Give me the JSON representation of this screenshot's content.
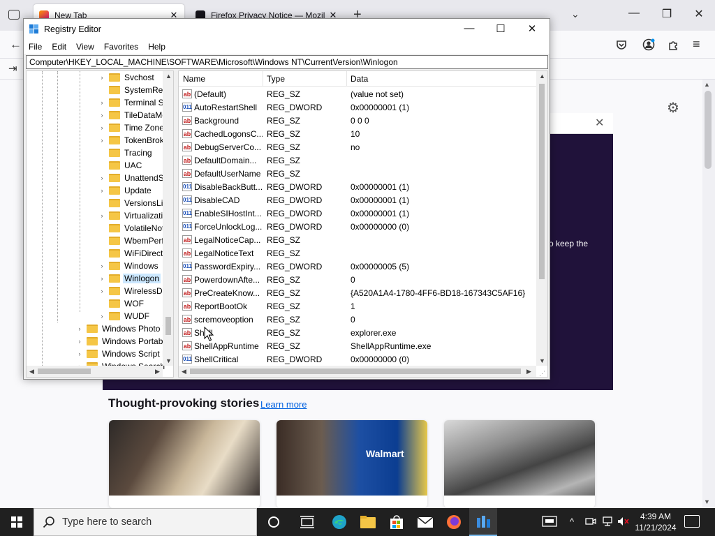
{
  "firefox": {
    "tabs": [
      {
        "label": "New Tab",
        "close": "✕"
      },
      {
        "label": "Firefox Privacy Notice — Mozil",
        "close": "✕"
      }
    ],
    "new_tab": "+",
    "tabs_menu": "⌄",
    "window_controls": {
      "minimize": "—",
      "maximize": "❐",
      "close": "✕"
    },
    "nav": {
      "back": "←",
      "import": "⇥"
    },
    "toolbar_icons": {
      "pocket": "pocket-icon",
      "account": "account-icon",
      "extensions": "extensions-icon",
      "menu": "≡"
    },
    "gear": "⚙",
    "dialog_close": "✕",
    "promo_text": "o keep the",
    "stories_title": "Thought-provoking stories",
    "learn_more": "Learn more",
    "card_brand": "Walmart"
  },
  "regedit": {
    "title": "Registry Editor",
    "window_controls": {
      "minimize": "—",
      "maximize": "☐",
      "close": "✕"
    },
    "menu": [
      "File",
      "Edit",
      "View",
      "Favorites",
      "Help"
    ],
    "address": "Computer\\HKEY_LOCAL_MACHINE\\SOFTWARE\\Microsoft\\Windows NT\\CurrentVersion\\Winlogon",
    "tree": [
      {
        "label": "Svchost",
        "expandable": true
      },
      {
        "label": "SystemRest",
        "expandable": false
      },
      {
        "label": "Terminal Se",
        "expandable": true
      },
      {
        "label": "TileDataMo",
        "expandable": true
      },
      {
        "label": "Time Zones",
        "expandable": true
      },
      {
        "label": "TokenBroke",
        "expandable": true
      },
      {
        "label": "Tracing",
        "expandable": false
      },
      {
        "label": "UAC",
        "expandable": false
      },
      {
        "label": "UnattendSe",
        "expandable": true
      },
      {
        "label": "Update",
        "expandable": true
      },
      {
        "label": "VersionsList",
        "expandable": false
      },
      {
        "label": "Virtualizatic",
        "expandable": true
      },
      {
        "label": "VolatileNot",
        "expandable": false
      },
      {
        "label": "WbemPerf",
        "expandable": false
      },
      {
        "label": "WiFiDirectA",
        "expandable": false
      },
      {
        "label": "Windows",
        "expandable": true
      },
      {
        "label": "Winlogon",
        "expandable": true,
        "selected": true
      },
      {
        "label": "WirelessDo",
        "expandable": true
      },
      {
        "label": "WOF",
        "expandable": false
      },
      {
        "label": "WUDF",
        "expandable": true
      },
      {
        "label": "Windows Photo V",
        "expandable": true,
        "level": 0
      },
      {
        "label": "Windows Portabl",
        "expandable": true,
        "level": 0
      },
      {
        "label": "Windows Script H",
        "expandable": true,
        "level": 0
      },
      {
        "label": "Windows Search",
        "expandable": true,
        "level": 0
      }
    ],
    "columns": {
      "name": "Name",
      "type": "Type",
      "data": "Data"
    },
    "values": [
      {
        "name": "(Default)",
        "type": "REG_SZ",
        "data": "(value not set)"
      },
      {
        "name": "AutoRestartShell",
        "type": "REG_DWORD",
        "data": "0x00000001 (1)"
      },
      {
        "name": "Background",
        "type": "REG_SZ",
        "data": "0 0 0"
      },
      {
        "name": "CachedLogonsC...",
        "type": "REG_SZ",
        "data": "10"
      },
      {
        "name": "DebugServerCo...",
        "type": "REG_SZ",
        "data": "no"
      },
      {
        "name": "DefaultDomain...",
        "type": "REG_SZ",
        "data": ""
      },
      {
        "name": "DefaultUserName",
        "type": "REG_SZ",
        "data": ""
      },
      {
        "name": "DisableBackButt...",
        "type": "REG_DWORD",
        "data": "0x00000001 (1)"
      },
      {
        "name": "DisableCAD",
        "type": "REG_DWORD",
        "data": "0x00000001 (1)"
      },
      {
        "name": "EnableSIHostInt...",
        "type": "REG_DWORD",
        "data": "0x00000001 (1)"
      },
      {
        "name": "ForceUnlockLog...",
        "type": "REG_DWORD",
        "data": "0x00000000 (0)"
      },
      {
        "name": "LegalNoticeCap...",
        "type": "REG_SZ",
        "data": ""
      },
      {
        "name": "LegalNoticeText",
        "type": "REG_SZ",
        "data": ""
      },
      {
        "name": "PasswordExpiry...",
        "type": "REG_DWORD",
        "data": "0x00000005 (5)"
      },
      {
        "name": "PowerdownAfte...",
        "type": "REG_SZ",
        "data": "0"
      },
      {
        "name": "PreCreateKnow...",
        "type": "REG_SZ",
        "data": "{A520A1A4-1780-4FF6-BD18-167343C5AF16}"
      },
      {
        "name": "ReportBootOk",
        "type": "REG_SZ",
        "data": "1"
      },
      {
        "name": "scremoveoption",
        "type": "REG_SZ",
        "data": "0"
      },
      {
        "name": "Shell",
        "type": "REG_SZ",
        "data": "explorer.exe"
      },
      {
        "name": "ShellAppRuntime",
        "type": "REG_SZ",
        "data": "ShellAppRuntime.exe"
      },
      {
        "name": "ShellCritical",
        "type": "REG_DWORD",
        "data": "0x00000000 (0)"
      }
    ],
    "icon_sz": "ab",
    "icon_dword": "011"
  },
  "taskbar": {
    "search_placeholder": "Type here to search",
    "time": "4:39 AM",
    "date": "11/21/2024",
    "tray_up": "^"
  },
  "colors": {
    "promo_bg": "#20123a",
    "selection": "#cce8ff",
    "taskbar_bg": "#202020",
    "link": "#0061e0"
  }
}
